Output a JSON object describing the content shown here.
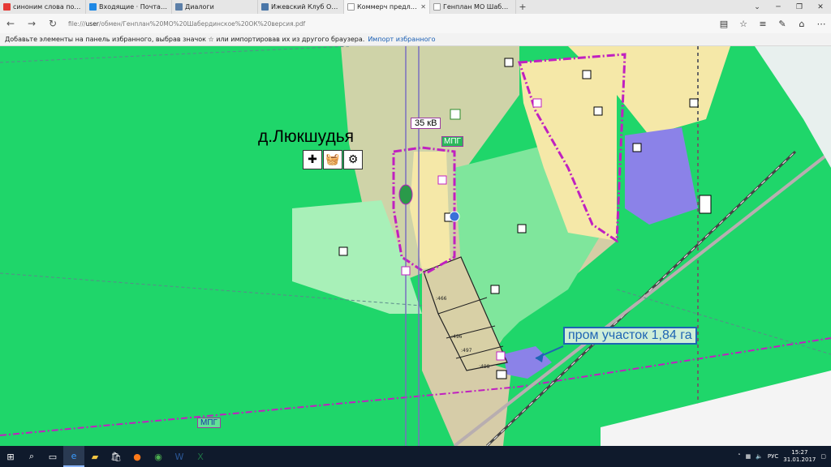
{
  "tabs": [
    {
      "label": "синоним слова порт — Ян",
      "icon_color": "#e53935"
    },
    {
      "label": "Входящие · Почта Mail.Ru",
      "icon_color": "#1e88e5"
    },
    {
      "label": "Диалоги",
      "icon_color": "#5c7fa8"
    },
    {
      "label": "Ижевский Клуб Ораторов",
      "icon_color": "#4a76a8"
    },
    {
      "label": "Коммерч предложени",
      "icon_color": "#ffffff",
      "active": true
    },
    {
      "label": "Генплан МО Шабердин",
      "icon_color": "#ffffff"
    }
  ],
  "address": {
    "prefix": "file:///",
    "user": "user",
    "rest": "/обмен/Генплан%20МО%20Шабердинское%20ОК%20версия.pdf"
  },
  "favbar": {
    "text": "Добавьте элементы на панель избранного, выбрав значок ☆ или импортировав их из другого браузера.",
    "link": "Импорт избранного"
  },
  "map": {
    "village": "д.Люкшудья",
    "kv": "35 кВ",
    "mpg_top": "МПГ",
    "mpg_bottom": "МПГ",
    "prom": "пром участок 1,84 га",
    "plots": [
      ":466",
      ":496",
      ":497",
      ":498"
    ]
  },
  "taskbar": {
    "lang": "РУС",
    "time": "15:27",
    "date": "31.01.2017"
  },
  "colors": {
    "green": "#1fd66a",
    "light_green": "#a8f0b8",
    "tan": "#d8cfa8",
    "purple": "#9b3aa0",
    "blue_zone": "#8b82e8"
  }
}
